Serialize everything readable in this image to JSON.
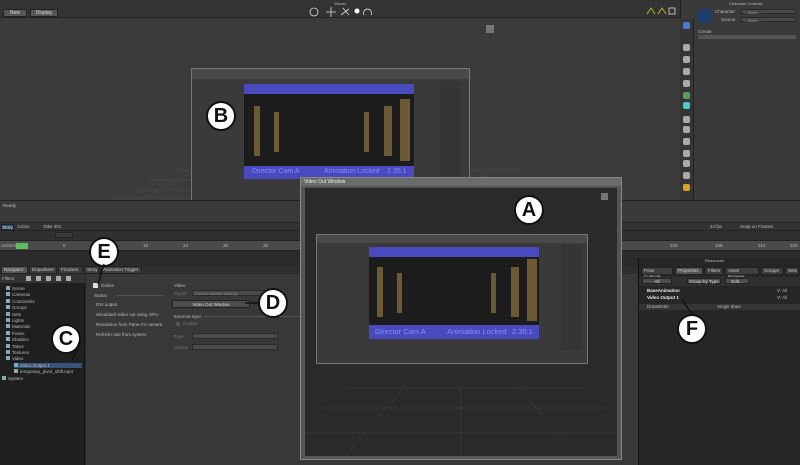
{
  "viewer": {
    "title": "Viewer",
    "new_btn": "New",
    "display_btn": "Display"
  },
  "char_panel": {
    "title": "Character Controls",
    "character_label": "Character:",
    "character_value": "-- None --",
    "source_label": "Source:",
    "source_value": "-- None --",
    "create_label": "Create"
  },
  "status": {
    "ready": "Ready"
  },
  "story": {
    "story_tab": "Story",
    "action_tab": "Action",
    "take": "Take 001",
    "action_label": "Action",
    "fps": "24 fps",
    "snap": "Snap on Frames"
  },
  "ruler": {
    "ticks": [
      "0",
      "6",
      "12",
      "18",
      "24",
      "30",
      "36",
      "42",
      "48",
      "96",
      "102",
      "108",
      "114",
      "120"
    ]
  },
  "tabs": [
    "Navigator",
    "Dopesheet",
    "FCurves",
    "Story",
    "Animation Trigger"
  ],
  "filters": {
    "label": "Filters"
  },
  "tree": [
    "Scene",
    "Cameras",
    "Constraints",
    "Groups",
    "Sets",
    "Lights",
    "Materials",
    "Poses",
    "Shaders",
    "Takes",
    "Textures",
    "Video",
    "Video Output 1",
    "temporary_pivot_shift.mp4",
    "System"
  ],
  "video_props": {
    "online_label": "Online",
    "status_label": "Status",
    "dvi_label": "DVI output",
    "sim_label": "Simulated video out using GPU",
    "res_label": "Resolution from Pane 0's camera",
    "refresh_label": "Refresh rate from system",
    "video_section": "Video",
    "signal_label": "Signal",
    "signal_value": "Current monitor settings",
    "window_btn": "Video Out Window",
    "ext_sync": "External Sync",
    "enable_label": "Enable",
    "type_label": "Type",
    "source_label": "Source"
  },
  "video_window": {
    "title": "Video Out Window",
    "overlay_cam": "Director Cam A",
    "overlay_lock": "Animation Locked",
    "overlay_ratio": "2.35:1"
  },
  "resources": {
    "title": "Resources",
    "tabs": [
      "Pose Controls",
      "Properties",
      "Filters",
      "Asset Browser",
      "Groups",
      "Sets"
    ],
    "all_label": "All",
    "group_label": "Group by Type",
    "edit_label": "Edit...",
    "rows": [
      {
        "name": "BaseAnimation",
        "val": "V: All"
      },
      {
        "name": "Video Output 1",
        "val": "V: All"
      }
    ],
    "draw_mode_label": "DrawMode",
    "draw_mode_value": "Single draw"
  },
  "callouts": [
    "A",
    "B",
    "C",
    "D",
    "E",
    "F"
  ]
}
